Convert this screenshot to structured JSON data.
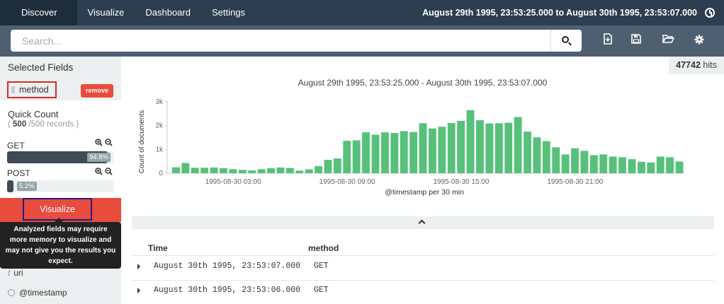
{
  "nav": {
    "tabs": [
      "Discover",
      "Visualize",
      "Dashboard",
      "Settings"
    ],
    "time_range": "August 29th 1995, 23:53:25.000 to August 30th 1995, 23:53:07.000"
  },
  "search": {
    "placeholder": "Search..."
  },
  "sidebar": {
    "selected_header": "Selected Fields",
    "selected_field": "method",
    "remove_label": "remove",
    "quick_count": {
      "title": "Quick Count",
      "records_prefix": "( ",
      "records_count": "500",
      "records_suffix": " /500 records )",
      "items": [
        {
          "label": "GET",
          "percent_label": "94.8%",
          "fraction": 0.948
        },
        {
          "label": "POST",
          "percent_label": "5.2%",
          "fraction": 0.052
        }
      ]
    },
    "visualize_label": "Visualize",
    "tooltip_line1": "Analyzed fields may require",
    "tooltip_line2": "more memory to visualize and",
    "tooltip_line3": "may not give you the results you",
    "tooltip_line4": "expect.",
    "fields": [
      {
        "type_icon": "t",
        "name": "uri"
      },
      {
        "type_icon": "clock-icon",
        "name": "@timestamp"
      }
    ]
  },
  "hits": {
    "count": "47742",
    "label": "hits"
  },
  "chart_data": {
    "type": "bar",
    "title": "August 29th 1995, 23:53:25.000 - August 30th 1995, 23:53:07.000",
    "xlabel": "@timestamp per 30 min",
    "ylabel": "Count of documents",
    "y_ticks": [
      "0",
      "1k",
      "2k",
      "3k"
    ],
    "ylim": [
      0,
      3000
    ],
    "x_ticks": [
      {
        "label": "1995-08-30 03:00",
        "index": 6
      },
      {
        "label": "1995-08-30 09:00",
        "index": 18
      },
      {
        "label": "1995-08-30 15:00",
        "index": 30
      },
      {
        "label": "1995-08-30 21:00",
        "index": 42
      }
    ],
    "values": [
      250,
      430,
      230,
      230,
      240,
      210,
      170,
      140,
      120,
      170,
      210,
      240,
      220,
      110,
      160,
      300,
      560,
      620,
      1360,
      1380,
      1720,
      1620,
      1720,
      1690,
      1770,
      1730,
      2100,
      1880,
      1950,
      2110,
      2200,
      2650,
      2230,
      2090,
      2100,
      2120,
      2360,
      1750,
      1510,
      1350,
      1090,
      790,
      1050,
      940,
      760,
      790,
      700,
      670,
      590,
      480,
      450,
      700,
      670,
      490
    ],
    "color": "#57c17b"
  },
  "table": {
    "headers": [
      "Time",
      "method"
    ],
    "rows": [
      [
        "August 30th 1995, 23:53:07.000",
        "GET"
      ],
      [
        "August 30th 1995, 23:53:06.000",
        "GET"
      ]
    ]
  }
}
